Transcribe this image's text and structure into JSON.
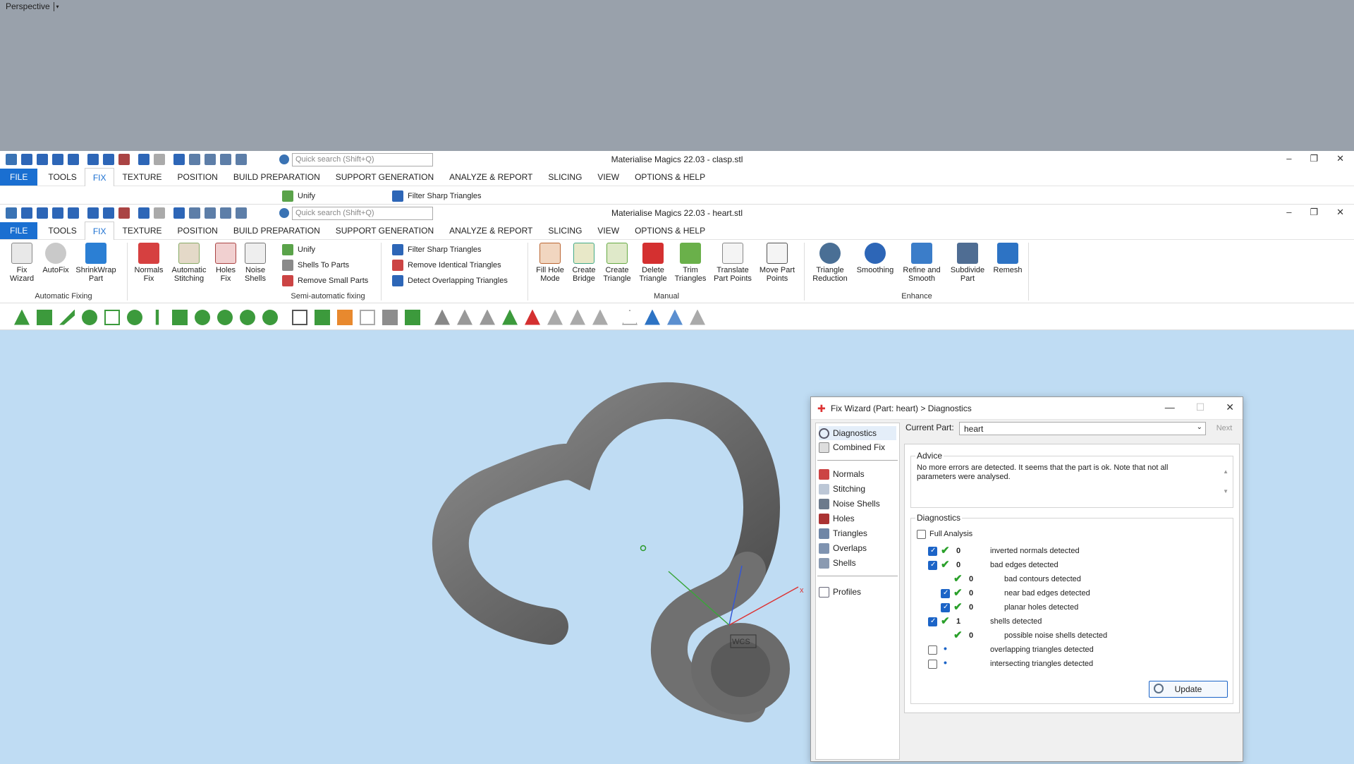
{
  "top_viewport": {
    "label": "Perspective",
    "dropdown": "▾"
  },
  "window_back": {
    "title": "Materialise Magics 22.03 - clasp.stl",
    "search_placeholder": "Quick search (Shift+Q)",
    "menu": [
      "FILE",
      "TOOLS",
      "FIX",
      "TEXTURE",
      "POSITION",
      "BUILD PREPARATION",
      "SUPPORT GENERATION",
      "ANALYZE & REPORT",
      "SLICING",
      "VIEW",
      "OPTIONS & HELP"
    ],
    "unify_label": "Unify",
    "filter_label": "Filter Sharp Triangles"
  },
  "window_front": {
    "title": "Materialise Magics 22.03 - heart.stl",
    "search_placeholder": "Quick search (Shift+Q)",
    "menu": [
      "FILE",
      "TOOLS",
      "FIX",
      "TEXTURE",
      "POSITION",
      "BUILD PREPARATION",
      "SUPPORT GENERATION",
      "ANALYZE & REPORT",
      "SLICING",
      "VIEW",
      "OPTIONS & HELP"
    ],
    "active_menu": "FIX",
    "controls": {
      "minimize": "–",
      "restore": "❐",
      "close": "✕"
    }
  },
  "ribbon": {
    "auto": {
      "group": "Automatic Fixing",
      "fix_wizard": [
        "Fix",
        "Wizard"
      ],
      "autofix": [
        "AutoFix"
      ],
      "shrinkwrap": [
        "ShrinkWrap",
        "Part"
      ]
    },
    "semi": {
      "group": "Semi-automatic fixing",
      "normals": [
        "Normals",
        "Fix"
      ],
      "stitching": [
        "Automatic",
        "Stitching"
      ],
      "holes": [
        "Holes",
        "Fix"
      ],
      "noise": [
        "Noise",
        "Shells"
      ],
      "unify": "Unify",
      "shells_to_parts": "Shells To Parts",
      "remove_small": "Remove Small Parts",
      "filter_sharp": "Filter Sharp Triangles",
      "remove_identical": "Remove Identical Triangles",
      "detect_overlap": "Detect Overlapping Triangles"
    },
    "manual": {
      "group": "Manual",
      "fill_hole": [
        "Fill Hole",
        "Mode"
      ],
      "create_bridge": [
        "Create",
        "Bridge"
      ],
      "create_triangle": [
        "Create",
        "Triangle"
      ],
      "delete_triangle": [
        "Delete",
        "Triangle"
      ],
      "trim": [
        "Trim",
        "Triangles"
      ],
      "translate": [
        "Translate",
        "Part Points"
      ],
      "move": [
        "Move Part",
        "Points"
      ]
    },
    "enhance": {
      "group": "Enhance",
      "reduction": [
        "Triangle",
        "Reduction"
      ],
      "smoothing": [
        "Smoothing"
      ],
      "refine": [
        "Refine and",
        "Smooth"
      ],
      "subdivide": [
        "Subdivide",
        "Part"
      ],
      "remesh": [
        "Remesh"
      ]
    }
  },
  "viewport": {
    "axis_label": "WCS",
    "x_axis": "x"
  },
  "dialog": {
    "title": "Fix Wizard (Part: heart) > Diagnostics",
    "controls": {
      "minimize": "—",
      "maximize": "☐",
      "close": "✕"
    },
    "nav": {
      "diagnostics": "Diagnostics",
      "combined": "Combined Fix",
      "normals": "Normals",
      "stitching": "Stitching",
      "noise": "Noise Shells",
      "holes": "Holes",
      "triangles": "Triangles",
      "overlaps": "Overlaps",
      "shells": "Shells",
      "profiles": "Profiles"
    },
    "current_part_label": "Current Part:",
    "current_part_value": "heart",
    "next_label": "Next",
    "advice_legend": "Advice",
    "advice_text": "No more errors are detected. It seems that the part is ok. Note that not all parameters were analysed.",
    "diag_legend": "Diagnostics",
    "full_analysis": "Full Analysis",
    "rows": [
      {
        "count": "0",
        "label": "inverted normals detected"
      },
      {
        "count": "0",
        "label": "bad edges detected"
      },
      {
        "count": "0",
        "label": "bad contours detected"
      },
      {
        "count": "0",
        "label": "near bad edges detected"
      },
      {
        "count": "0",
        "label": "planar holes detected"
      },
      {
        "count": "1",
        "label": "shells detected"
      },
      {
        "count": "0",
        "label": "possible noise shells detected"
      },
      {
        "count": "•",
        "label": "overlapping triangles detected"
      },
      {
        "count": "•",
        "label": "intersecting triangles detected"
      }
    ],
    "update_label": "Update"
  }
}
